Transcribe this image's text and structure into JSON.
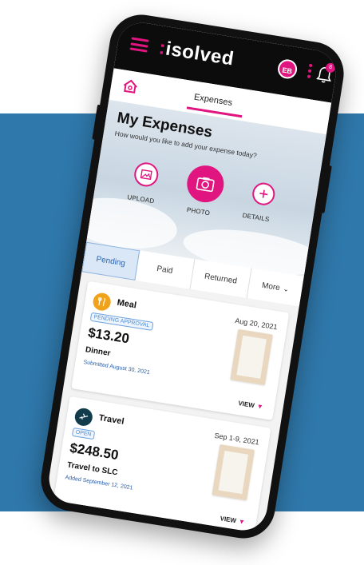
{
  "header": {
    "logo_mark": ":",
    "logo_text": "isolved",
    "avatar_initials": "EB",
    "notification_count": "8"
  },
  "subnav": {
    "active_tab": "Expenses"
  },
  "hero": {
    "title": "My Expenses",
    "subtitle": "How would you like to add your expense today?",
    "actions": [
      {
        "label": "UPLOAD"
      },
      {
        "label": "PHOTO"
      },
      {
        "label": "DETAILS"
      }
    ]
  },
  "tabs": [
    {
      "label": "Pending"
    },
    {
      "label": "Paid"
    },
    {
      "label": "Returned"
    },
    {
      "label": "More"
    }
  ],
  "expenses": [
    {
      "category": "Meal",
      "date": "Aug 20, 2021",
      "status": "PENDING APPROVAL",
      "amount": "$13.20",
      "description": "Dinner",
      "meta": "Submitted August 30, 2021",
      "action": "VIEW"
    },
    {
      "category": "Travel",
      "date": "Sep 1-9, 2021",
      "status": "OPEN",
      "amount": "$248.50",
      "description": "Travel to SLC",
      "meta": "Added September 12, 2021",
      "action": "VIEW"
    }
  ],
  "colors": {
    "brand": "#e0157f",
    "background_band": "#2f78ab",
    "tab_active": "#2a62b0",
    "meal_icon": "#f0a21b",
    "travel_icon": "#123c4c"
  }
}
